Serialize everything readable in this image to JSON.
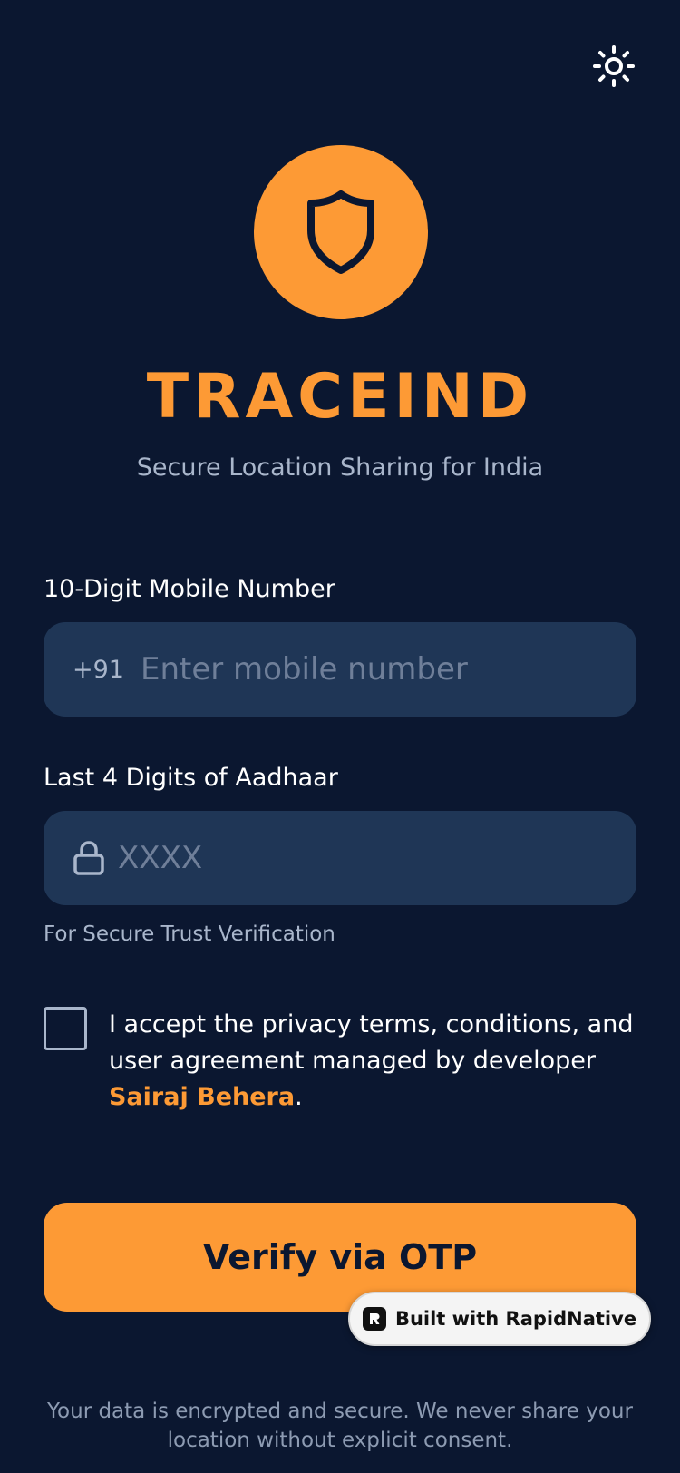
{
  "app": {
    "title": "TRACEIND",
    "subtitle": "Secure Location Sharing for India"
  },
  "header": {
    "theme_toggle_icon": "sun-icon"
  },
  "logo": {
    "icon": "shield-icon",
    "circle_color": "#fd9a35"
  },
  "form": {
    "mobile": {
      "label": "10-Digit Mobile Number",
      "prefix": "+91",
      "placeholder": "Enter mobile number",
      "value": ""
    },
    "aadhaar": {
      "label": "Last 4 Digits of Aadhaar",
      "icon": "lock-icon",
      "placeholder": "XXXX",
      "value": "",
      "helper": "For Secure Trust Verification"
    },
    "terms": {
      "checked": false,
      "text": "I accept the privacy terms, conditions, and user agreement managed by developer ",
      "developer_name": "Sairaj Behera",
      "suffix": "."
    },
    "submit_label": "Verify via OTP"
  },
  "badge": {
    "label": "Built with RapidNative",
    "icon": "rapidnative-logo-icon"
  },
  "footer": {
    "note": "Your data is encrypted and secure. We never share your location without explicit consent."
  },
  "colors": {
    "background": "#0b1730",
    "accent": "#fd9a35",
    "input_background": "#1f3656",
    "muted_text": "#a9b6cb"
  }
}
